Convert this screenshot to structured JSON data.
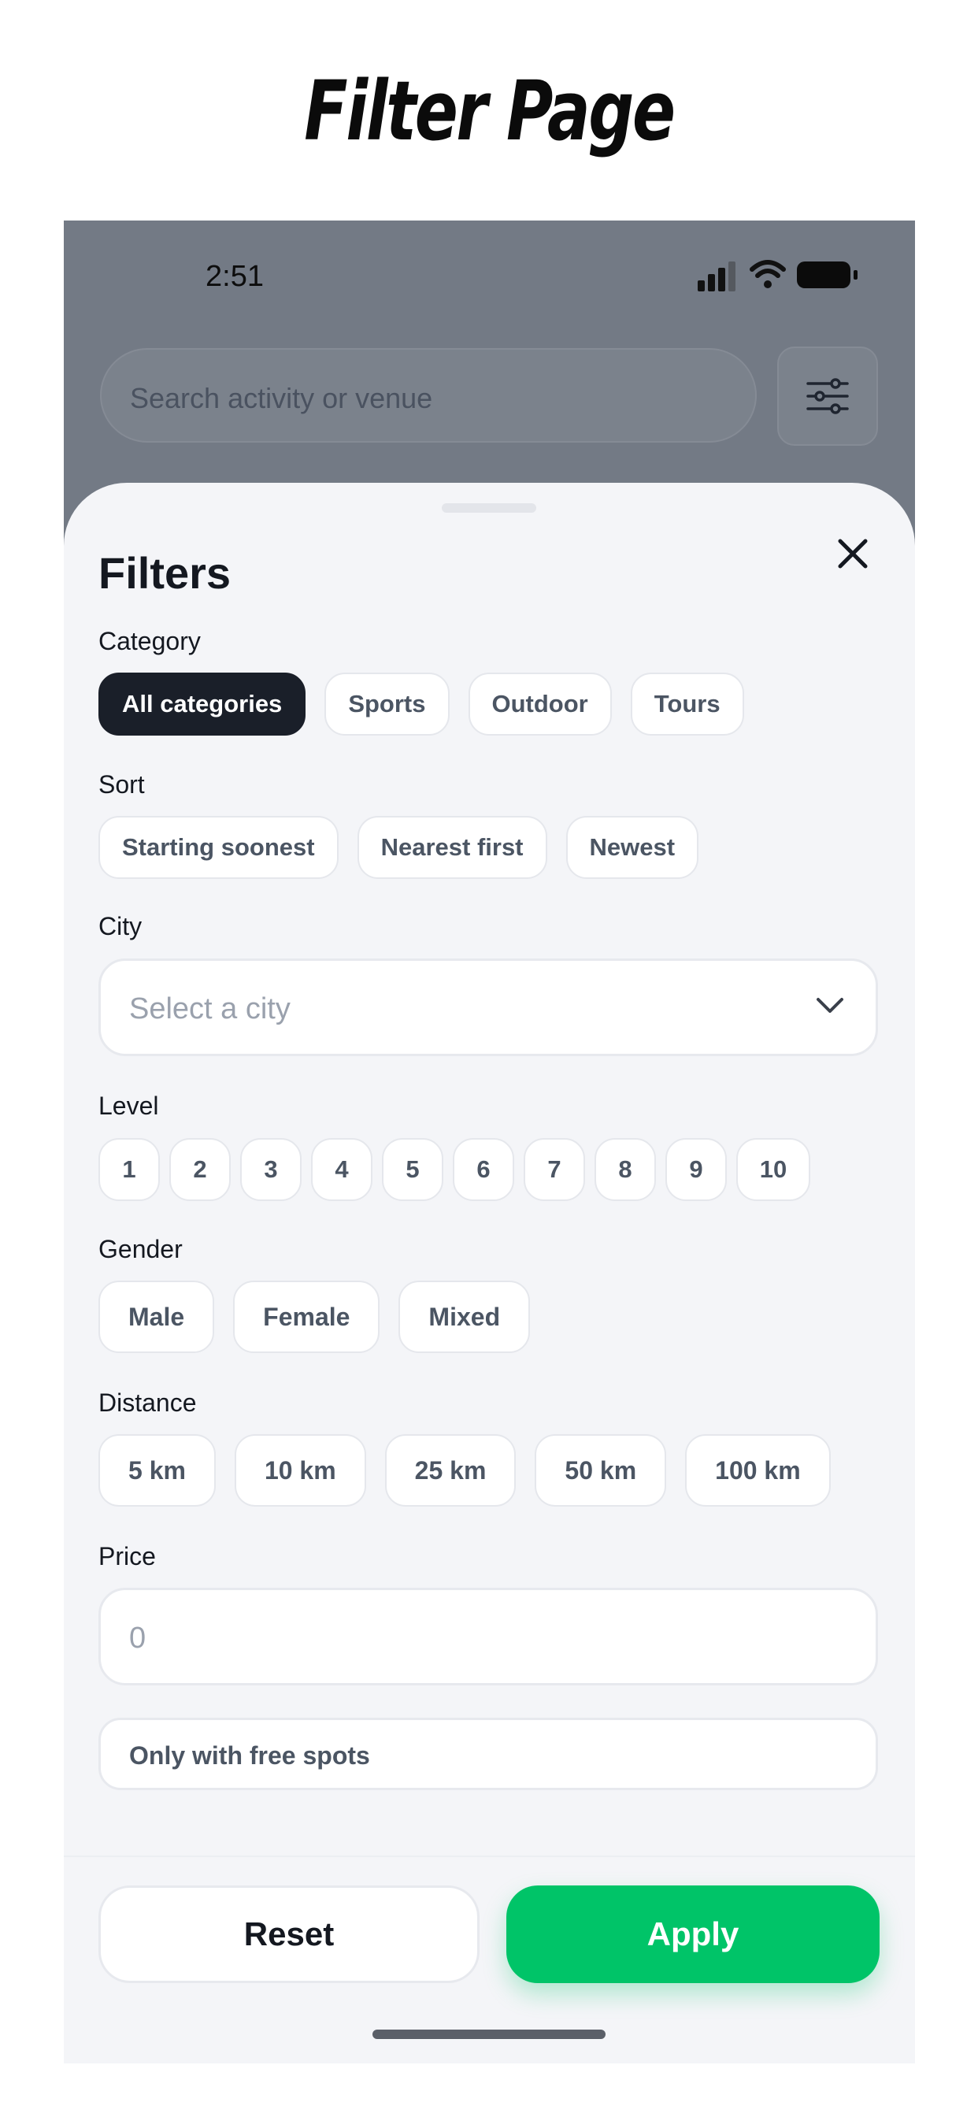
{
  "page_title": "Filter Page",
  "status_bar": {
    "time": "2:51"
  },
  "search": {
    "placeholder": "Search activity or venue"
  },
  "sheet": {
    "title": "Filters",
    "category": {
      "label": "Category",
      "options": [
        "All categories",
        "Sports",
        "Outdoor",
        "Tours"
      ],
      "selected": "All categories"
    },
    "sort": {
      "label": "Sort",
      "options": [
        "Starting soonest",
        "Nearest first",
        "Newest"
      ]
    },
    "city": {
      "label": "City",
      "placeholder": "Select a city"
    },
    "level": {
      "label": "Level",
      "options": [
        "1",
        "2",
        "3",
        "4",
        "5",
        "6",
        "7",
        "8",
        "9",
        "10"
      ]
    },
    "gender": {
      "label": "Gender",
      "options": [
        "Male",
        "Female",
        "Mixed"
      ]
    },
    "distance": {
      "label": "Distance",
      "options": [
        "5 km",
        "10 km",
        "25 km",
        "50 km",
        "100 km"
      ]
    },
    "price": {
      "label": "Price",
      "placeholder": "0"
    },
    "free_spots": {
      "label": "Only with free spots"
    },
    "actions": {
      "reset": "Reset",
      "apply": "Apply"
    }
  },
  "colors": {
    "accent": "#00c468",
    "chip_selected": "#1a1f29",
    "overlay": "#737a85",
    "sheet_bg": "#f4f5f8"
  }
}
